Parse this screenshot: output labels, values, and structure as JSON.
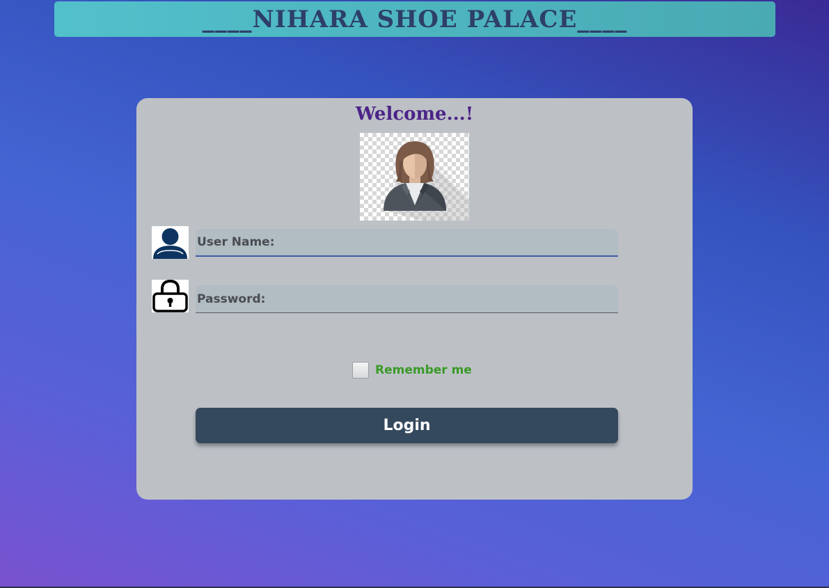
{
  "header": {
    "title": "____NIHARA SHOE PALACE____"
  },
  "login_card": {
    "welcome": "Welcome...!",
    "avatar_icon": "user-avatar-icon",
    "username": {
      "label": "User Name:",
      "value": "",
      "icon": "user-icon"
    },
    "password": {
      "label": "Password:",
      "value": "",
      "icon": "lock-icon"
    },
    "remember": {
      "label": "Remember me",
      "checked": false
    },
    "login_label": "Login"
  },
  "colors": {
    "title_bar": "#52c0cb",
    "title_text": "#2d3f68",
    "card": "#bdc1c6",
    "welcome_text": "#4b2388",
    "field_bg": "#b1bcc3",
    "remember_text": "#3a9a28",
    "login_button": "#35495e"
  }
}
